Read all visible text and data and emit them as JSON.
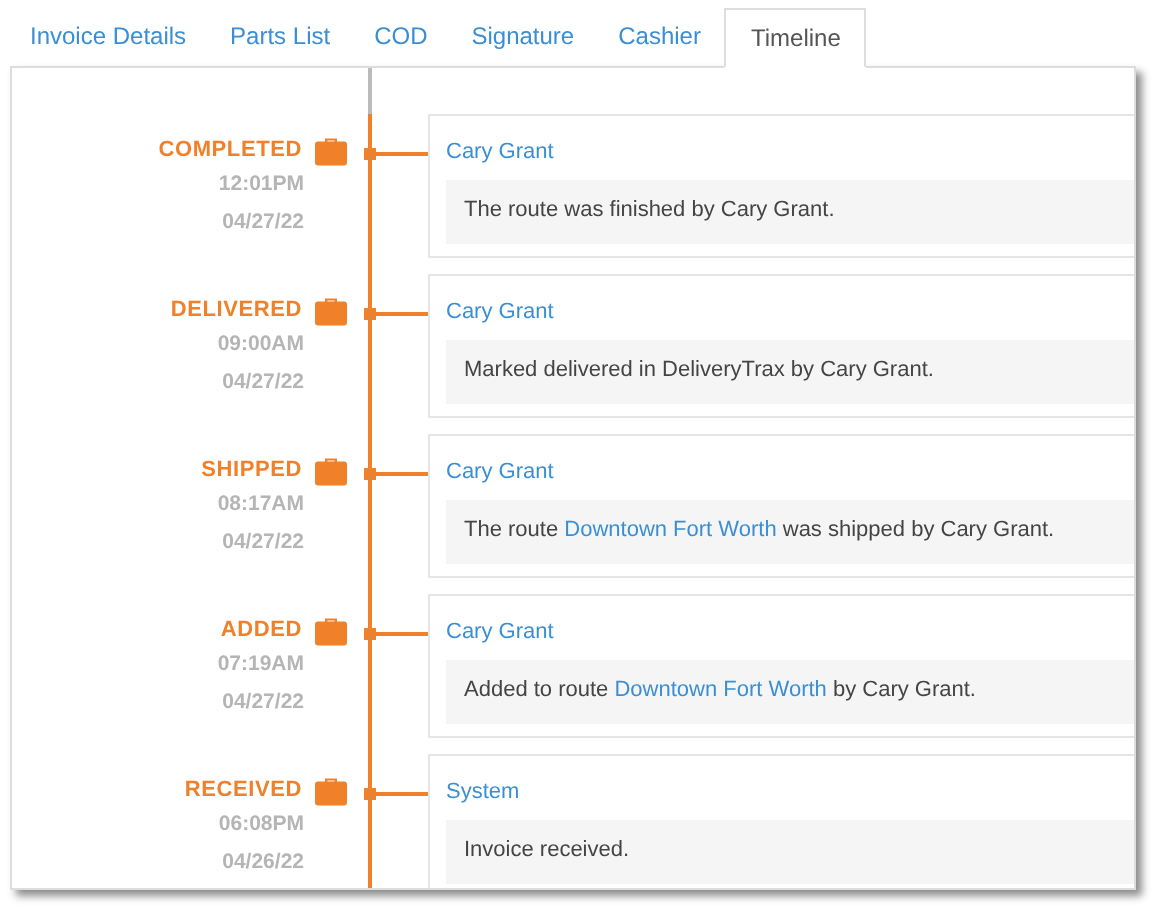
{
  "tabs": [
    {
      "label": "Invoice Details",
      "selected": false
    },
    {
      "label": "Parts List",
      "selected": false
    },
    {
      "label": "COD",
      "selected": false
    },
    {
      "label": "Signature",
      "selected": false
    },
    {
      "label": "Cashier",
      "selected": false
    },
    {
      "label": "Timeline",
      "selected": true
    }
  ],
  "timeline": [
    {
      "status": "COMPLETED",
      "time": "12:01PM",
      "date": "04/27/22",
      "author": "Cary Grant",
      "message": [
        {
          "kind": "text",
          "text": "The route was finished by Cary Grant."
        }
      ]
    },
    {
      "status": "DELIVERED",
      "time": "09:00AM",
      "date": "04/27/22",
      "author": "Cary Grant",
      "message": [
        {
          "kind": "text",
          "text": "Marked delivered in DeliveryTrax by Cary Grant."
        }
      ]
    },
    {
      "status": "SHIPPED",
      "time": "08:17AM",
      "date": "04/27/22",
      "author": "Cary Grant",
      "message": [
        {
          "kind": "text",
          "text": "The route "
        },
        {
          "kind": "link",
          "text": "Downtown Fort Worth"
        },
        {
          "kind": "text",
          "text": " was shipped by Cary Grant."
        }
      ]
    },
    {
      "status": "ADDED",
      "time": "07:19AM",
      "date": "04/27/22",
      "author": "Cary Grant",
      "message": [
        {
          "kind": "text",
          "text": "Added to route "
        },
        {
          "kind": "link",
          "text": "Downtown Fort Worth"
        },
        {
          "kind": "text",
          "text": " by Cary Grant."
        }
      ]
    },
    {
      "status": "RECEIVED",
      "time": "06:08PM",
      "date": "04/26/22",
      "author": "System",
      "message": [
        {
          "kind": "text",
          "text": "Invoice received."
        }
      ]
    }
  ]
}
